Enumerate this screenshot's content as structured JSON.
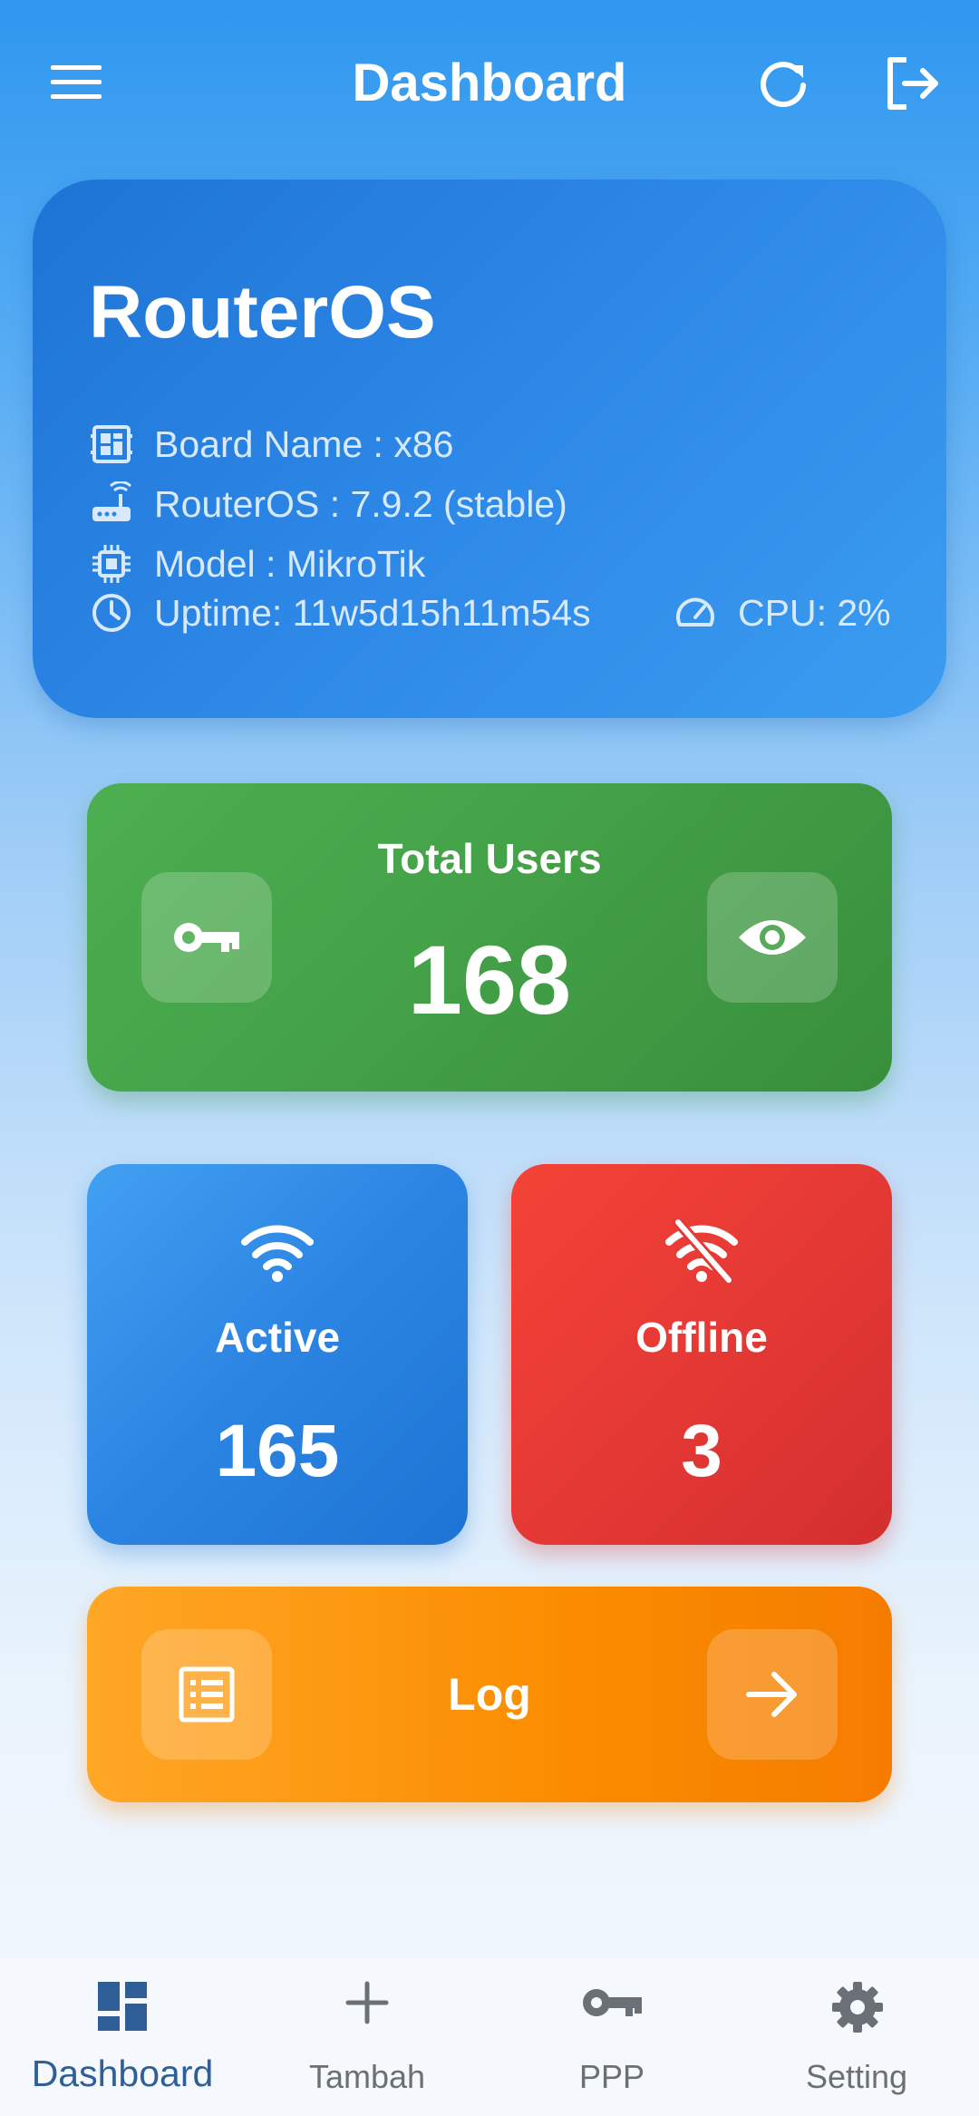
{
  "appbar": {
    "title": "Dashboard",
    "menu_icon": "menu-icon",
    "refresh_icon": "refresh-icon",
    "logout_icon": "logout-icon"
  },
  "router": {
    "title": "RouterOS",
    "board_name": "Board Name : x86",
    "version": "RouterOS : 7.9.2 (stable)",
    "model": "Model : MikroTik",
    "uptime": "Uptime: 11w5d15h11m54s",
    "cpu": "CPU: 2%"
  },
  "total_users": {
    "label": "Total Users",
    "value": "168",
    "left_icon": "key-icon",
    "right_icon": "eye-icon"
  },
  "active": {
    "label": "Active",
    "value": "165",
    "icon": "wifi-icon"
  },
  "offline": {
    "label": "Offline",
    "value": "3",
    "icon": "wifi-off-icon"
  },
  "log": {
    "label": "Log",
    "left_icon": "list-icon",
    "right_icon": "arrow-right-icon"
  },
  "bottom_nav": [
    {
      "label": "Dashboard",
      "icon": "dashboard-icon",
      "selected": true
    },
    {
      "label": "Tambah",
      "icon": "plus-icon",
      "selected": false
    },
    {
      "label": "PPP",
      "icon": "key-icon",
      "selected": false
    },
    {
      "label": "Setting",
      "icon": "gear-icon",
      "selected": false
    }
  ],
  "colors": {
    "green": "#43a047",
    "blue": "#2b84e2",
    "red": "#e53935",
    "orange": "#fb8c00",
    "nav_selected": "#2f5f96"
  }
}
